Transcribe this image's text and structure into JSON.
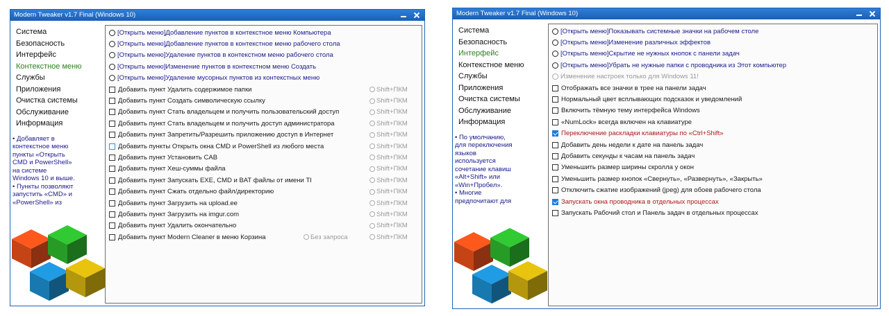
{
  "win1": {
    "title": "Modern Tweaker v1.7 Final (Windows 10)",
    "nav": [
      "Система",
      "Безопасность",
      "Интерфейс",
      "Контекстное меню",
      "Службы",
      "Приложения",
      "Очистка системы",
      "Обслуживание",
      "Информация"
    ],
    "active_index": 3,
    "desc": [
      "• Добавляет в",
      "контекстное меню",
      "пункты «Открыть",
      "CMD и PowerShell»",
      "на системе",
      "Windows 10 и выше.",
      "• Пункты позволяют",
      "запустить «CMD» и",
      "«PowerShell» из"
    ],
    "radios": [
      {
        "link": "[Открыть меню]",
        "text": " Добавление пунктов в контекстное меню Компьютера"
      },
      {
        "link": "[Открыть меню]",
        "text": " Добавление пунктов в контекстное меню рабочего стола"
      },
      {
        "link": "[Открыть меню]",
        "text": " Удаление пунктов в контекстном меню рабочего стола"
      },
      {
        "link": "[Открыть меню]",
        "text": " Изменение пунктов в контекстном меню Создать"
      },
      {
        "link": "[Открыть меню]",
        "text": " Удаление мусорных пунктов из контекстных меню"
      }
    ],
    "checks": [
      {
        "label": "Добавить пункт Удалить содержимое папки",
        "shift": "Shift+ПКМ"
      },
      {
        "label": "Добавить пункт Создать символическую ссылку",
        "shift": "Shift+ПКМ"
      },
      {
        "label": "Добавить пункт Стать владельцем и получить пользовательский доступ",
        "shift": "Shift+ПКМ"
      },
      {
        "label": "Добавить пункт Стать владельцем и получить доступ администратора",
        "shift": "Shift+ПКМ"
      },
      {
        "label": "Добавить пункт Запретить/Разрешить приложению доступ в Интернет",
        "shift": "Shift+ПКМ"
      },
      {
        "label": "Добавить пункты Открыть окна CMD и PowerShell из любого места",
        "shift": "Shift+ПКМ",
        "hl": true
      },
      {
        "label": "Добавить пункт Установить CAB",
        "shift": "Shift+ПКМ"
      },
      {
        "label": "Добавить пункт Хеш-суммы файла",
        "shift": "Shift+ПКМ"
      },
      {
        "label": "Добавить пункт Запускать EXE, CMD и BAT файлы от имени TI",
        "shift": "Shift+ПКМ"
      },
      {
        "label": "Добавить пункт Сжать отдельно файл/директорию",
        "shift": "Shift+ПКМ"
      },
      {
        "label": "Добавить пункт Загрузить на upload.ee",
        "shift": "Shift+ПКМ"
      },
      {
        "label": "Добавить пункт Загрузить на imgur.com",
        "shift": "Shift+ПКМ"
      },
      {
        "label": "Добавить пункт Удалить окончательно",
        "shift": "Shift+ПКМ"
      },
      {
        "label": "Добавить пункт Modern Cleaner в меню Корзина",
        "shift": "Shift+ПКМ",
        "extra": "Без запроса"
      }
    ]
  },
  "win2": {
    "title": "Modern Tweaker v1.7 Final (Windows 10)",
    "nav": [
      "Система",
      "Безопасность",
      "Интерфейс",
      "Контекстное меню",
      "Службы",
      "Приложения",
      "Очистка системы",
      "Обслуживание",
      "Информация"
    ],
    "active_index": 2,
    "desc": [
      "• По умолчанию,",
      "для переключения",
      "языков",
      "используется",
      "сочетание клавиш",
      "«Alt+Shift» или",
      "«Win+Пробел».",
      "• Многие",
      "предпочитают для"
    ],
    "radios": [
      {
        "link": "[Открыть меню]",
        "text": " Показывать системные значки на рабочем столе"
      },
      {
        "link": "[Открыть меню]",
        "text": " Изменение различных эффектов"
      },
      {
        "link": "[Открыть меню]",
        "text": " Скрытие не нужных кнопок с панели задач"
      },
      {
        "link": "[Открыть меню]",
        "text": " Убрать не нужные папки с проводника из Этот компьютер"
      },
      {
        "link": "",
        "text": "Изменение настроек только для Windows 11!",
        "dim": true
      }
    ],
    "checks": [
      {
        "label": "Отображать все значки в трее на панели задач"
      },
      {
        "label": "Нормальный цвет всплывающих подсказок и уведомлений"
      },
      {
        "label": "Включить тёмную тему интерфейса Windows"
      },
      {
        "label": "«NumLock» всегда включен на клавиатуре"
      },
      {
        "label": "Переключение раскладки клавиатуры по «Ctrl+Shift»",
        "checked": true,
        "red": true
      },
      {
        "label": "Добавить день недели к дате на панель задач"
      },
      {
        "label": "Добавить секунды к часам на панель задач"
      },
      {
        "label": "Уменьшить размер ширины скролла у окон"
      },
      {
        "label": "Уменьшить размер кнопок «Свернуть», «Развернуть», «Закрыть»"
      },
      {
        "label": "Отключить сжатие изображений (jpeg) для обоев рабочего стола"
      },
      {
        "label": "Запускать окна проводника в отдельных процессах",
        "checked": true,
        "red": true
      },
      {
        "label": "Запускать Рабочий стол и Панель задач в отдельных процессах"
      }
    ]
  },
  "colors": {
    "title_bar": "#1b5fb3",
    "active_nav": "#2e7d1f",
    "link": "#1a1a8c",
    "warning": "#b01818",
    "check": "#1f7ae0"
  },
  "logo": {
    "name": "modern-tweaker-logo",
    "cube_colors": [
      "#e8501a",
      "#2db82d",
      "#1c8ecf",
      "#d4b20e"
    ]
  }
}
